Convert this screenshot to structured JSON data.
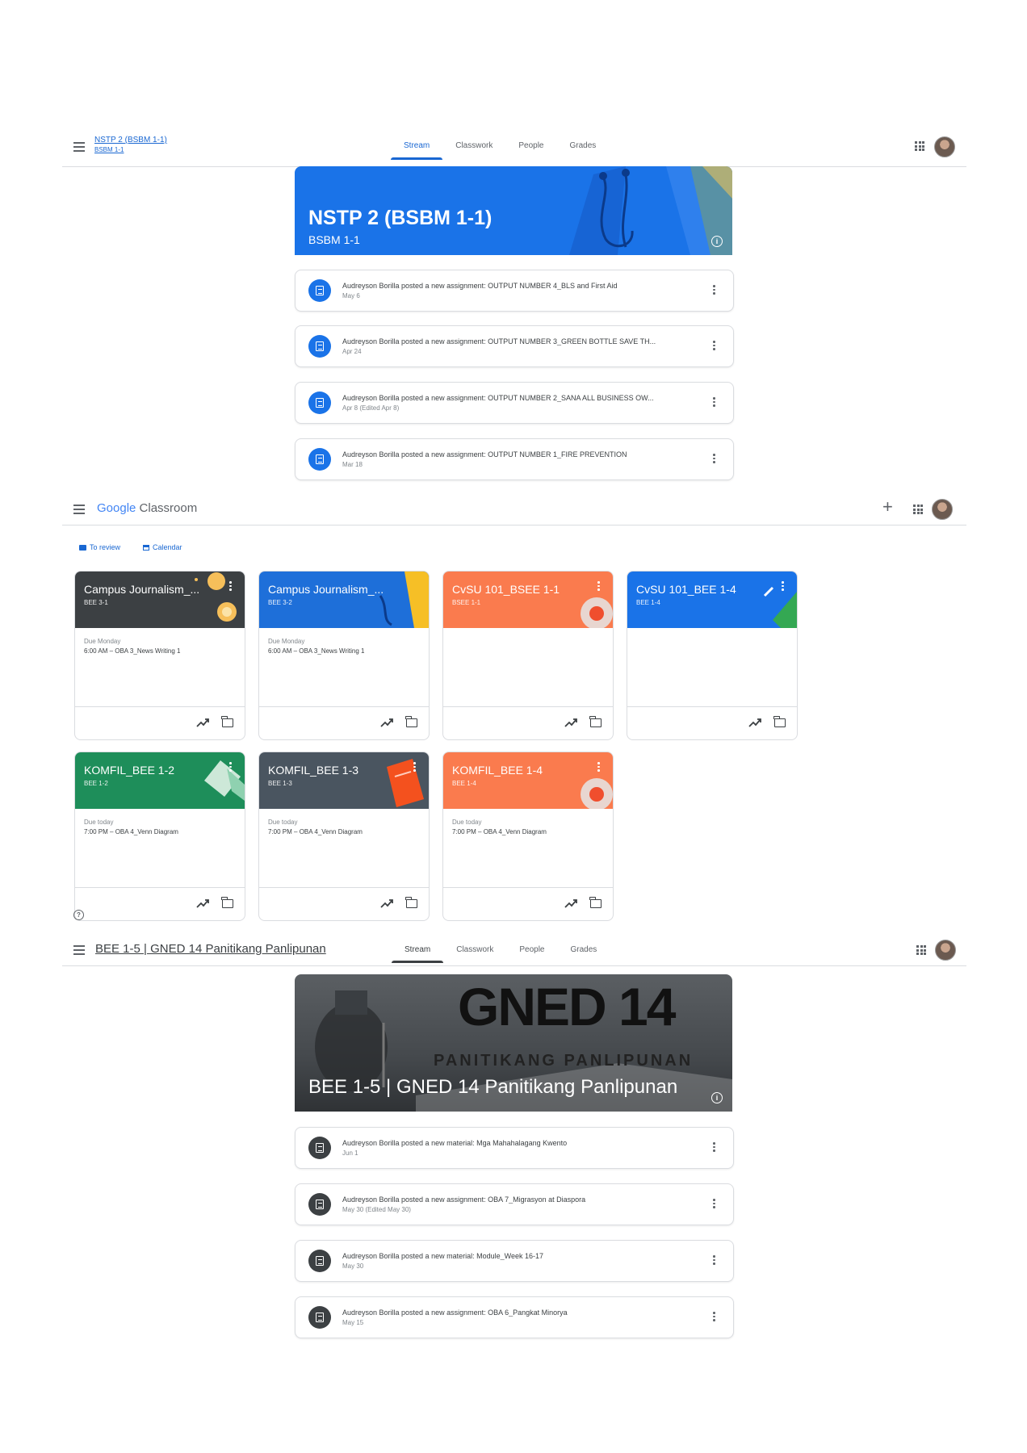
{
  "section1": {
    "course_title": "NSTP 2 (BSBM 1-1)",
    "course_subtitle": "BSBM 1-1",
    "tabs": [
      "Stream",
      "Classwork",
      "People",
      "Grades"
    ],
    "banner_title": "NSTP 2 (BSBM 1-1)",
    "banner_sub": "BSBM 1-1",
    "posts": [
      {
        "text": "Audreyson Borilla posted a new assignment: OUTPUT NUMBER 4_BLS and First Aid",
        "date": "May 6"
      },
      {
        "text": "Audreyson Borilla posted a new assignment: OUTPUT NUMBER 3_GREEN BOTTLE SAVE TH...",
        "date": "Apr 24"
      },
      {
        "text": "Audreyson Borilla posted a new assignment: OUTPUT NUMBER 2_SANA ALL BUSINESS OW...",
        "date": "Apr 8 (Edited Apr 8)"
      },
      {
        "text": "Audreyson Borilla posted a new assignment: OUTPUT NUMBER 1_FIRE PREVENTION",
        "date": "Mar 18"
      }
    ]
  },
  "section2": {
    "logo_google": "Google",
    "logo_classroom": "Classroom",
    "to_review": "To review",
    "calendar": "Calendar",
    "cards": [
      {
        "name": "Campus Journalism_...",
        "section": "BEE 3-1",
        "due": "Due Monday",
        "work": "6:00 AM – OBA 3_News Writing 1",
        "color": "#3c4043"
      },
      {
        "name": "Campus Journalism_...",
        "section": "BEE 3-2",
        "due": "Due Monday",
        "work": "6:00 AM – OBA 3_News Writing 1",
        "color": "#1e6fd9"
      },
      {
        "name": "CvSU 101_BSEE 1-1",
        "section": "BSEE 1-1",
        "due": "",
        "work": "",
        "color": "#fa7b4e"
      },
      {
        "name": "CvSU 101_BEE 1-4",
        "section": "BEE 1-4",
        "due": "",
        "work": "",
        "color": "#1a73e8"
      },
      {
        "name": "KOMFIL_BEE 1-2",
        "section": "BEE 1-2",
        "due": "Due today",
        "work": "7:00 PM – OBA 4_Venn Diagram",
        "color": "#1e8e5a"
      },
      {
        "name": "KOMFIL_BEE 1-3",
        "section": "BEE 1-3",
        "due": "Due today",
        "work": "7:00 PM – OBA 4_Venn Diagram",
        "color": "#4a5560"
      },
      {
        "name": "KOMFIL_BEE 1-4",
        "section": "BEE 1-4",
        "due": "Due today",
        "work": "7:00 PM – OBA 4_Venn Diagram",
        "color": "#fa7b4e"
      }
    ]
  },
  "section3": {
    "course_title": "BEE 1-5 | GNED 14 Panitikang Panlipunan",
    "tabs": [
      "Stream",
      "Classwork",
      "People",
      "Grades"
    ],
    "banner_big": "GNED 14",
    "banner_mid": "PANITIKANG PANLIPUNAN",
    "banner_title": "BEE 1-5 | GNED 14 Panitikang Panlipunan",
    "posts": [
      {
        "text": "Audreyson Borilla posted a new material: Mga Mahahalagang Kwento",
        "date": "Jun 1"
      },
      {
        "text": "Audreyson Borilla posted a new assignment: OBA 7_Migrasyon at Diaspora",
        "date": "May 30 (Edited May 30)"
      },
      {
        "text": "Audreyson Borilla posted a new material: Module_Week 16-17",
        "date": "May 30"
      },
      {
        "text": "Audreyson Borilla posted a new assignment: OBA 6_Pangkat Minorya",
        "date": "May 15"
      }
    ]
  },
  "colors": {
    "blue": "#1967d2",
    "banner_blue": "#1a73e8",
    "post_icon_blue": "#1a73e8",
    "post_icon_dark": "#3c4043"
  },
  "icons": [
    "menu-icon",
    "apps-icon",
    "avatar",
    "info-icon",
    "assignment-icon",
    "more-vert-icon",
    "plus-icon",
    "to-review-icon",
    "calendar-icon",
    "trending-icon",
    "folder-icon",
    "help-icon"
  ]
}
